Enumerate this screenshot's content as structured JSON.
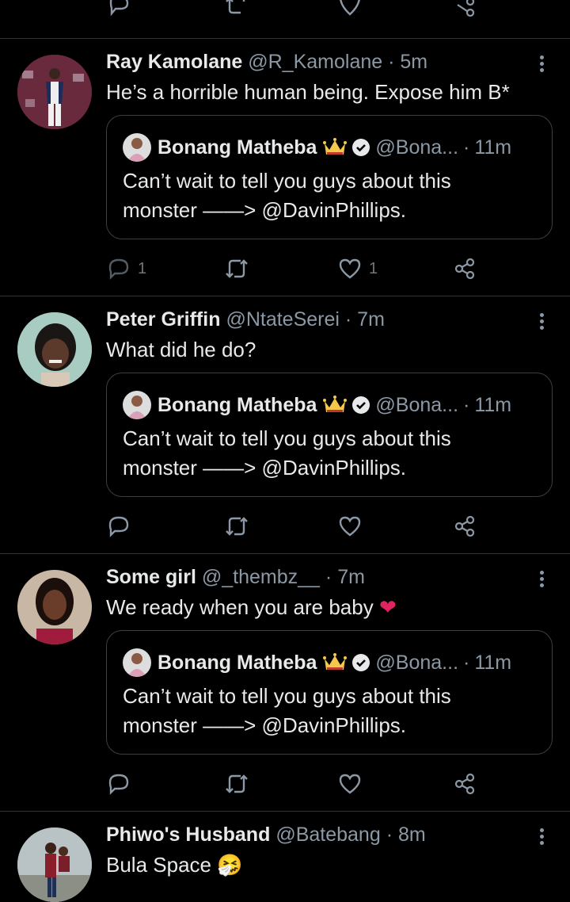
{
  "top_actions": {
    "reply": "",
    "retweet": "",
    "like": "",
    "share": ""
  },
  "tweets": [
    {
      "name": "Ray Kamolane",
      "handle": "@R_Kamolane",
      "dot": "·",
      "time": "5m",
      "text": "He’s a horrible human being. Expose him B*",
      "quote": {
        "name": "Bonang Matheba",
        "handle": "@Bona...",
        "dot": "·",
        "time": "11m",
        "line1": "Can’t wait to tell you guys about this",
        "line2": "monster ——> @DavinPhillips."
      },
      "reply_count": "1",
      "like_count": "1"
    },
    {
      "name": "Peter Griffin",
      "handle": "@NtateSerei",
      "dot": "·",
      "time": "7m",
      "text": "What did he do?",
      "quote": {
        "name": "Bonang Matheba",
        "handle": "@Bona...",
        "dot": "·",
        "time": "11m",
        "line1": "Can’t wait to tell you guys about this",
        "line2": "monster ——> @DavinPhillips."
      },
      "reply_count": "",
      "like_count": ""
    },
    {
      "name": "Some girl",
      "handle": "@_thembz__",
      "dot": "·",
      "time": "7m",
      "text": "We ready when you are baby",
      "emoji": "❤",
      "quote": {
        "name": "Bonang Matheba",
        "handle": "@Bona...",
        "dot": "·",
        "time": "11m",
        "line1": "Can’t wait to tell you guys about this",
        "line2": "monster ——> @DavinPhillips."
      },
      "reply_count": "",
      "like_count": ""
    },
    {
      "name": "Phiwo's Husband",
      "handle": "@Batebang",
      "dot": "·",
      "time": "8m",
      "text": "Bula Space",
      "emoji": "🤧"
    }
  ],
  "colors": {
    "background": "#000000",
    "text": "#e7e9ea",
    "muted": "#8b98a5",
    "divider": "#2f3336",
    "heart": "#e0245e"
  }
}
